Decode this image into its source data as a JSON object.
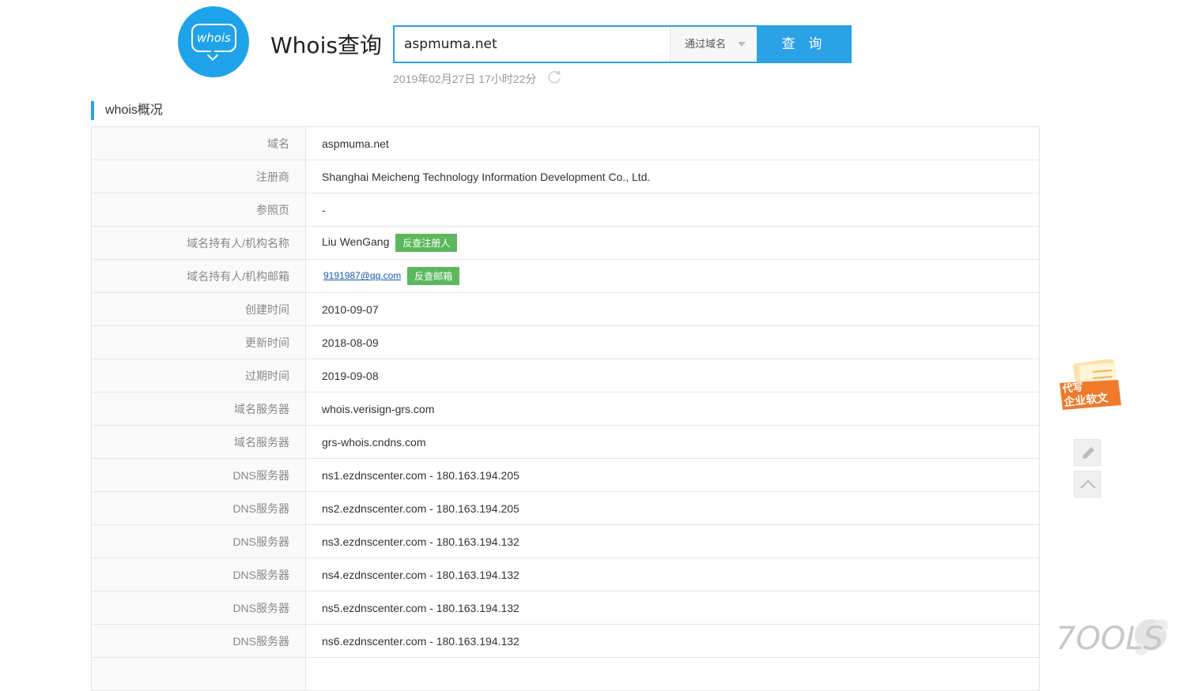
{
  "header": {
    "logo_text": "whois",
    "title": "Whois查询",
    "search": {
      "value": "aspmuma.net",
      "mode": "通过域名",
      "button": "查 询"
    },
    "timestamp": "2019年02月27日 17小时22分"
  },
  "section": {
    "title": "whois概况"
  },
  "rows": [
    {
      "label": "域名",
      "value": "aspmuma.net"
    },
    {
      "label": "注册商",
      "value": "Shanghai Meicheng Technology Information Development Co., Ltd."
    },
    {
      "label": "参照页",
      "value": "-"
    },
    {
      "label": "域名持有人/机构名称",
      "value": "Liu WenGang",
      "tag": "反查注册人"
    },
    {
      "label": "域名持有人/机构邮箱",
      "value": "9191987@qq.com",
      "tag": "反查邮箱"
    },
    {
      "label": "创建时间",
      "value": "2010-09-07"
    },
    {
      "label": "更新时间",
      "value": "2018-08-09"
    },
    {
      "label": "过期时间",
      "value": "2019-09-08"
    },
    {
      "label": "域名服务器",
      "value": "whois.verisign-grs.com"
    },
    {
      "label": "域名服务器",
      "value": "grs-whois.cndns.com"
    },
    {
      "label": "DNS服务器",
      "value": "ns1.ezdnscenter.com - 180.163.194.205"
    },
    {
      "label": "DNS服务器",
      "value": "ns2.ezdnscenter.com - 180.163.194.205"
    },
    {
      "label": "DNS服务器",
      "value": "ns3.ezdnscenter.com - 180.163.194.132"
    },
    {
      "label": "DNS服务器",
      "value": "ns4.ezdnscenter.com - 180.163.194.132"
    },
    {
      "label": "DNS服务器",
      "value": "ns5.ezdnscenter.com - 180.163.194.132"
    },
    {
      "label": "DNS服务器",
      "value": "ns6.ezdnscenter.com - 180.163.194.132"
    }
  ],
  "side": {
    "ad_line1": "代写",
    "ad_line2": "企业软文",
    "edit_icon": "pencil-icon",
    "top_icon": "chevron-up-icon"
  },
  "watermark": {
    "text": "7OOLS"
  },
  "colors": {
    "accent": "#2ba1e6",
    "logo": "#1ea3ea",
    "tag": "#5cb85c",
    "ad": "#f07a2a"
  }
}
